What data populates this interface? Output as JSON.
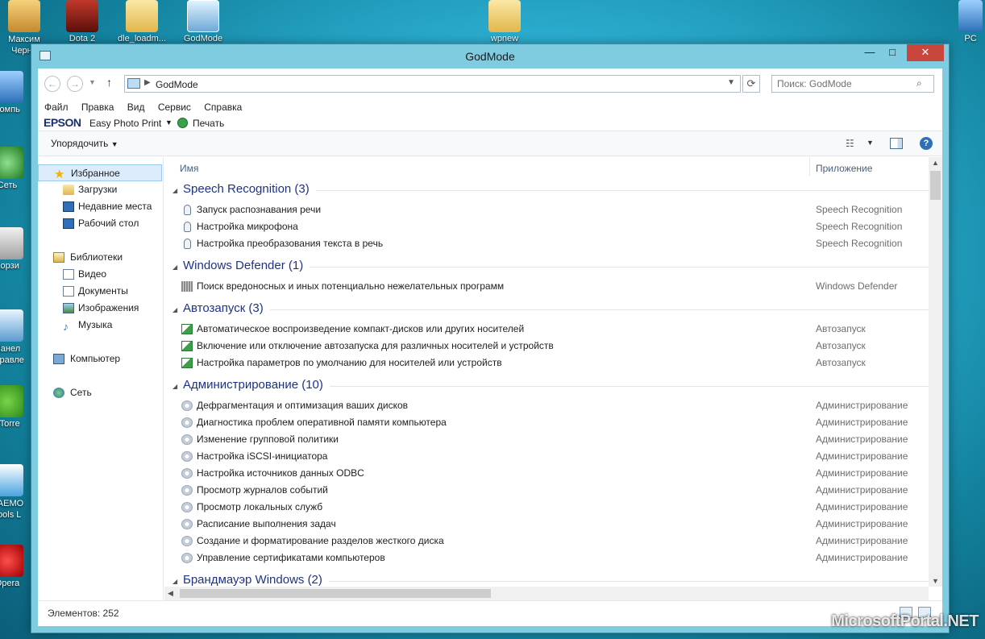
{
  "desktop": {
    "icons": [
      {
        "label": "Максим\nЧерне",
        "icon": "user-folder-icon"
      },
      {
        "label": "Dota 2",
        "icon": "dota-icon"
      },
      {
        "label": "dle_loadm...",
        "icon": "folder-icon"
      },
      {
        "label": "GodMode",
        "icon": "godmode-icon"
      },
      {
        "label": "wpnew",
        "icon": "folder-icon"
      },
      {
        "label": "PC",
        "icon": "pc-icon"
      },
      {
        "label": "Компь",
        "icon": "computer-icon"
      },
      {
        "label": "Сеть",
        "icon": "network-icon"
      },
      {
        "label": "Корзи",
        "icon": "recycle-bin-icon"
      },
      {
        "label": "Панел\nуправле",
        "icon": "control-panel-icon"
      },
      {
        "label": "µTorre",
        "icon": "utorrent-icon"
      },
      {
        "label": "DAEMO\nTools L",
        "icon": "daemon-tools-icon"
      },
      {
        "label": "Opera",
        "icon": "opera-icon"
      }
    ],
    "watermark": "MicrosoftPortal.NET"
  },
  "window": {
    "title": "GodMode",
    "controls": {
      "minimize": "—",
      "maximize": "□",
      "close": "✕"
    }
  },
  "address_bar": {
    "path": "GodMode",
    "search_placeholder": "Поиск: GodMode"
  },
  "menu": [
    "Файл",
    "Правка",
    "Вид",
    "Сервис",
    "Справка"
  ],
  "epson_bar": {
    "logo": "EPSON",
    "app": "Easy Photo Print",
    "print": "Печать"
  },
  "command_bar": {
    "organize": "Упорядочить"
  },
  "nav_pane": {
    "favorites": {
      "label": "Избранное",
      "items": [
        "Загрузки",
        "Недавние места",
        "Рабочий стол"
      ]
    },
    "libraries": {
      "label": "Библиотеки",
      "items": [
        "Видео",
        "Документы",
        "Изображения",
        "Музыка"
      ]
    },
    "computer": "Компьютер",
    "network": "Сеть"
  },
  "columns": {
    "name": "Имя",
    "app": "Приложение"
  },
  "groups": [
    {
      "title": "Speech Recognition (3)",
      "icon": "microphone-icon",
      "items": [
        {
          "name": "Запуск распознавания речи",
          "app": "Speech Recognition"
        },
        {
          "name": "Настройка микрофона",
          "app": "Speech Recognition"
        },
        {
          "name": "Настройка преобразования текста в речь",
          "app": "Speech Recognition"
        }
      ]
    },
    {
      "title": "Windows Defender (1)",
      "icon": "defender-icon",
      "items": [
        {
          "name": "Поиск вредоносных и иных потенциально нежелательных программ",
          "app": "Windows Defender"
        }
      ]
    },
    {
      "title": "Автозапуск (3)",
      "icon": "autoplay-icon",
      "items": [
        {
          "name": "Автоматическое воспроизведение компакт-дисков или других носителей",
          "app": "Автозапуск"
        },
        {
          "name": "Включение или отключение автозапуска для различных носителей и устройств",
          "app": "Автозапуск"
        },
        {
          "name": "Настройка параметров по умолчанию для носителей или устройств",
          "app": "Автозапуск"
        }
      ]
    },
    {
      "title": "Администрирование (10)",
      "icon": "admin-tools-icon",
      "items": [
        {
          "name": "Дефрагментация и оптимизация ваших дисков",
          "app": "Администрирование"
        },
        {
          "name": "Диагностика проблем оперативной памяти компьютера",
          "app": "Администрирование"
        },
        {
          "name": "Изменение групповой политики",
          "app": "Администрирование"
        },
        {
          "name": "Настройка iSCSI-инициатора",
          "app": "Администрирование"
        },
        {
          "name": "Настройка источников данных ODBC",
          "app": "Администрирование"
        },
        {
          "name": "Просмотр журналов событий",
          "app": "Администрирование"
        },
        {
          "name": "Просмотр локальных служб",
          "app": "Администрирование"
        },
        {
          "name": "Расписание выполнения задач",
          "app": "Администрирование"
        },
        {
          "name": "Создание и форматирование разделов жесткого диска",
          "app": "Администрирование"
        },
        {
          "name": "Управление сертификатами компьютеров",
          "app": "Администрирование"
        }
      ]
    },
    {
      "title": "Брандмауэр Windows (2)",
      "icon": "firewall-icon",
      "items": []
    }
  ],
  "status": {
    "count": "Элементов: 252"
  }
}
